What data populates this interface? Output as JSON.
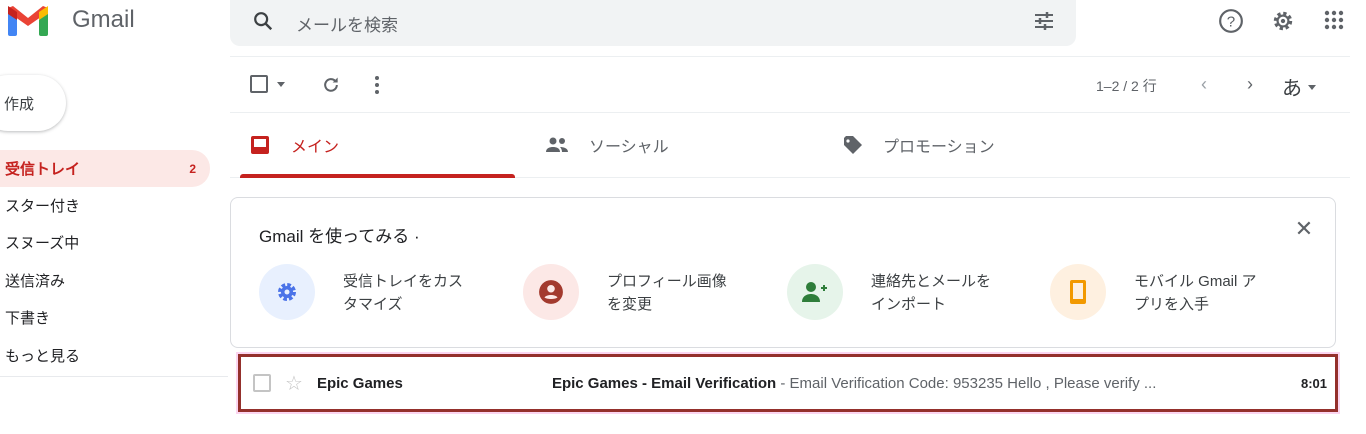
{
  "app": {
    "name": "Gmail"
  },
  "search": {
    "placeholder": "メールを検索"
  },
  "sidebar": {
    "compose": "作成",
    "items": [
      {
        "label": "受信トレイ",
        "count": "2",
        "active": true
      },
      {
        "label": "スター付き"
      },
      {
        "label": "スヌーズ中"
      },
      {
        "label": "送信済み"
      },
      {
        "label": "下書き"
      },
      {
        "label": "もっと見る"
      }
    ]
  },
  "toolbar": {
    "pagination": "1–2 / 2 行",
    "input_tool": "あ"
  },
  "tabs": [
    {
      "label": "メイン"
    },
    {
      "label": "ソーシャル"
    },
    {
      "label": "プロモーション"
    }
  ],
  "promo": {
    "title": "Gmail を使ってみる ·",
    "features": [
      {
        "line1": "受信トレイをカス",
        "line2": "タマイズ",
        "color": "#e8f0fe",
        "icon": "gear-icon"
      },
      {
        "line1": "プロフィール画像",
        "line2": "を変更",
        "color": "#fce8e6",
        "icon": "account-icon"
      },
      {
        "line1": "連絡先とメールを",
        "line2": "インポート",
        "color": "#e6f4ea",
        "icon": "person-add-icon"
      },
      {
        "line1": "モバイル Gmail ア",
        "line2": "プリを入手",
        "color": "#fef7e0",
        "icon": "phone-icon"
      }
    ]
  },
  "emails": [
    {
      "sender": "Epic Games",
      "subject": "Epic Games - Email Verification",
      "snippet": " - Email Verification Code: 953235 Hello , Please verify ...",
      "time": "8:01"
    }
  ],
  "colors": {
    "accent": "#c5221f",
    "highlight_border": "#94302c"
  }
}
